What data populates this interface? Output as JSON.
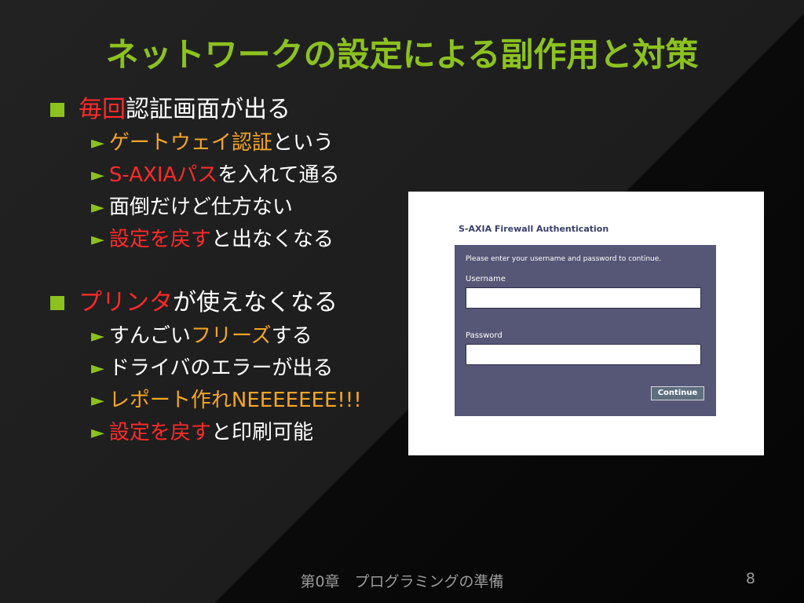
{
  "title": "ネットワークの設定による副作用と対策",
  "sections": [
    {
      "heading": {
        "red": "毎回",
        "white": "認証画面が出る"
      },
      "items": [
        {
          "parts": [
            {
              "text": "ゲートウェイ認証",
              "color": "orange"
            },
            {
              "text": "という",
              "color": "white"
            }
          ]
        },
        {
          "parts": [
            {
              "text": "S-AXIAパス",
              "color": "red"
            },
            {
              "text": "を入れて通る",
              "color": "white"
            }
          ]
        },
        {
          "parts": [
            {
              "text": "面倒だけど仕方ない",
              "color": "white"
            }
          ]
        },
        {
          "parts": [
            {
              "text": "設定を戻す",
              "color": "red"
            },
            {
              "text": "と出なくなる",
              "color": "white"
            }
          ]
        }
      ]
    },
    {
      "heading": {
        "red": "プリンタ",
        "white": "が使えなくなる"
      },
      "items": [
        {
          "parts": [
            {
              "text": "すんごい",
              "color": "white"
            },
            {
              "text": "フリーズ",
              "color": "orange"
            },
            {
              "text": "する",
              "color": "white"
            }
          ]
        },
        {
          "parts": [
            {
              "text": "ドライバのエラーが出る",
              "color": "white"
            }
          ]
        },
        {
          "parts": [
            {
              "text": "レポート作れNEEEEEEE!!!",
              "color": "orange"
            }
          ]
        },
        {
          "parts": [
            {
              "text": "設定を戻す",
              "color": "red"
            },
            {
              "text": "と印刷可能",
              "color": "white"
            }
          ]
        }
      ]
    }
  ],
  "screenshot": {
    "heading": "S-AXIA Firewall Authentication",
    "message": "Please enter your username and password to continue.",
    "username_label": "Username",
    "username_value": "",
    "password_label": "Password",
    "password_value": "",
    "continue_label": "Continue"
  },
  "footer": "第0章　プログラミングの準備",
  "page_number": "8",
  "colors": {
    "accent_green": "#8cc21e",
    "red": "#ff2a2a",
    "orange": "#f5a623",
    "panel": "#565677"
  }
}
